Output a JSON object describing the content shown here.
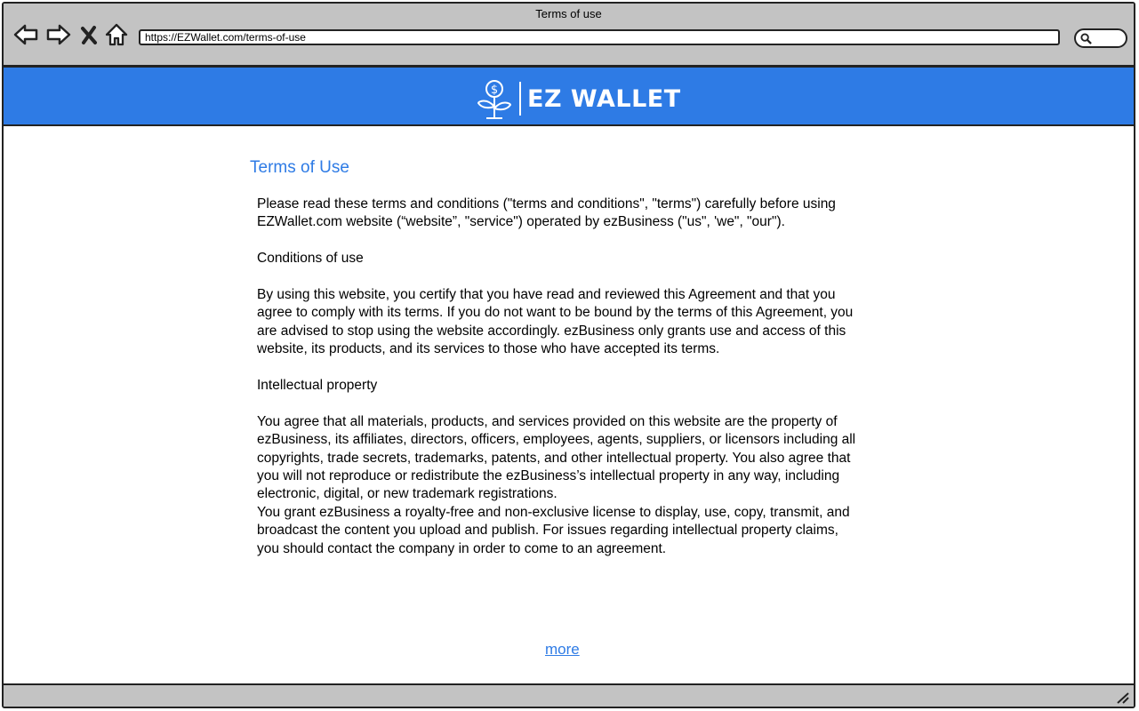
{
  "browser": {
    "window_title": "Terms of use",
    "url": "https://EZWallet.com/terms-of-use"
  },
  "header": {
    "brand": "EZ WALLET",
    "logo_icon": "money-plant-icon",
    "background_color": "#2e7be5"
  },
  "page": {
    "title": "Terms of Use",
    "intro": "Please read these terms and conditions (\"terms and conditions\", \"terms\") carefully before using EZWallet.com website (“website”, \"service\") operated by ezBusiness (\"us\", 'we\", \"our\").",
    "sections": [
      {
        "heading": "Conditions of use",
        "paragraphs": [
          "By using this website, you certify that you have read and reviewed this Agreement and that you agree to comply with its terms. If you do not want to be bound by the terms of this Agreement, you are advised to stop using the website accordingly. ezBusiness only grants use and access of this website, its products, and its services to those who have accepted its terms."
        ]
      },
      {
        "heading": "Intellectual property",
        "paragraphs": [
          "You agree that all materials, products, and services provided on this website are the property of ezBusiness, its affiliates, directors, officers, employees, agents, suppliers, or licensors including all copyrights, trade secrets, trademarks, patents, and other intellectual property. You also agree that you will not reproduce or redistribute the ezBusiness’s intellectual property in any way, including electronic, digital, or new trademark registrations.",
          "You grant ezBusiness a royalty-free and non-exclusive license to display, use, copy, transmit, and broadcast the content you upload and publish. For issues regarding intellectual property claims, you should contact the company in order to come to an agreement."
        ]
      }
    ],
    "more_link": "more",
    "accent_color": "#2e7be5"
  }
}
